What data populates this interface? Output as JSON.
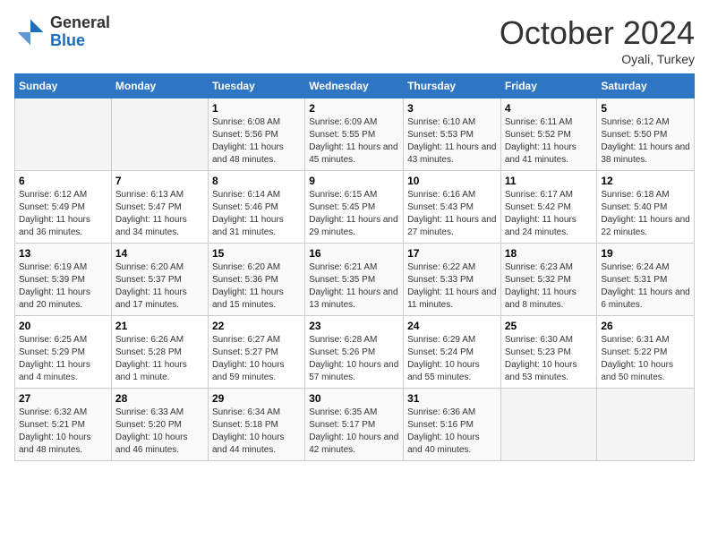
{
  "logo": {
    "general": "General",
    "blue": "Blue"
  },
  "title": "October 2024",
  "location": "Oyali, Turkey",
  "days_of_week": [
    "Sunday",
    "Monday",
    "Tuesday",
    "Wednesday",
    "Thursday",
    "Friday",
    "Saturday"
  ],
  "weeks": [
    [
      {
        "day": "",
        "info": ""
      },
      {
        "day": "",
        "info": ""
      },
      {
        "day": "1",
        "info": "Sunrise: 6:08 AM\nSunset: 5:56 PM\nDaylight: 11 hours and 48 minutes."
      },
      {
        "day": "2",
        "info": "Sunrise: 6:09 AM\nSunset: 5:55 PM\nDaylight: 11 hours and 45 minutes."
      },
      {
        "day": "3",
        "info": "Sunrise: 6:10 AM\nSunset: 5:53 PM\nDaylight: 11 hours and 43 minutes."
      },
      {
        "day": "4",
        "info": "Sunrise: 6:11 AM\nSunset: 5:52 PM\nDaylight: 11 hours and 41 minutes."
      },
      {
        "day": "5",
        "info": "Sunrise: 6:12 AM\nSunset: 5:50 PM\nDaylight: 11 hours and 38 minutes."
      }
    ],
    [
      {
        "day": "6",
        "info": "Sunrise: 6:12 AM\nSunset: 5:49 PM\nDaylight: 11 hours and 36 minutes."
      },
      {
        "day": "7",
        "info": "Sunrise: 6:13 AM\nSunset: 5:47 PM\nDaylight: 11 hours and 34 minutes."
      },
      {
        "day": "8",
        "info": "Sunrise: 6:14 AM\nSunset: 5:46 PM\nDaylight: 11 hours and 31 minutes."
      },
      {
        "day": "9",
        "info": "Sunrise: 6:15 AM\nSunset: 5:45 PM\nDaylight: 11 hours and 29 minutes."
      },
      {
        "day": "10",
        "info": "Sunrise: 6:16 AM\nSunset: 5:43 PM\nDaylight: 11 hours and 27 minutes."
      },
      {
        "day": "11",
        "info": "Sunrise: 6:17 AM\nSunset: 5:42 PM\nDaylight: 11 hours and 24 minutes."
      },
      {
        "day": "12",
        "info": "Sunrise: 6:18 AM\nSunset: 5:40 PM\nDaylight: 11 hours and 22 minutes."
      }
    ],
    [
      {
        "day": "13",
        "info": "Sunrise: 6:19 AM\nSunset: 5:39 PM\nDaylight: 11 hours and 20 minutes."
      },
      {
        "day": "14",
        "info": "Sunrise: 6:20 AM\nSunset: 5:37 PM\nDaylight: 11 hours and 17 minutes."
      },
      {
        "day": "15",
        "info": "Sunrise: 6:20 AM\nSunset: 5:36 PM\nDaylight: 11 hours and 15 minutes."
      },
      {
        "day": "16",
        "info": "Sunrise: 6:21 AM\nSunset: 5:35 PM\nDaylight: 11 hours and 13 minutes."
      },
      {
        "day": "17",
        "info": "Sunrise: 6:22 AM\nSunset: 5:33 PM\nDaylight: 11 hours and 11 minutes."
      },
      {
        "day": "18",
        "info": "Sunrise: 6:23 AM\nSunset: 5:32 PM\nDaylight: 11 hours and 8 minutes."
      },
      {
        "day": "19",
        "info": "Sunrise: 6:24 AM\nSunset: 5:31 PM\nDaylight: 11 hours and 6 minutes."
      }
    ],
    [
      {
        "day": "20",
        "info": "Sunrise: 6:25 AM\nSunset: 5:29 PM\nDaylight: 11 hours and 4 minutes."
      },
      {
        "day": "21",
        "info": "Sunrise: 6:26 AM\nSunset: 5:28 PM\nDaylight: 11 hours and 1 minute."
      },
      {
        "day": "22",
        "info": "Sunrise: 6:27 AM\nSunset: 5:27 PM\nDaylight: 10 hours and 59 minutes."
      },
      {
        "day": "23",
        "info": "Sunrise: 6:28 AM\nSunset: 5:26 PM\nDaylight: 10 hours and 57 minutes."
      },
      {
        "day": "24",
        "info": "Sunrise: 6:29 AM\nSunset: 5:24 PM\nDaylight: 10 hours and 55 minutes."
      },
      {
        "day": "25",
        "info": "Sunrise: 6:30 AM\nSunset: 5:23 PM\nDaylight: 10 hours and 53 minutes."
      },
      {
        "day": "26",
        "info": "Sunrise: 6:31 AM\nSunset: 5:22 PM\nDaylight: 10 hours and 50 minutes."
      }
    ],
    [
      {
        "day": "27",
        "info": "Sunrise: 6:32 AM\nSunset: 5:21 PM\nDaylight: 10 hours and 48 minutes."
      },
      {
        "day": "28",
        "info": "Sunrise: 6:33 AM\nSunset: 5:20 PM\nDaylight: 10 hours and 46 minutes."
      },
      {
        "day": "29",
        "info": "Sunrise: 6:34 AM\nSunset: 5:18 PM\nDaylight: 10 hours and 44 minutes."
      },
      {
        "day": "30",
        "info": "Sunrise: 6:35 AM\nSunset: 5:17 PM\nDaylight: 10 hours and 42 minutes."
      },
      {
        "day": "31",
        "info": "Sunrise: 6:36 AM\nSunset: 5:16 PM\nDaylight: 10 hours and 40 minutes."
      },
      {
        "day": "",
        "info": ""
      },
      {
        "day": "",
        "info": ""
      }
    ]
  ]
}
